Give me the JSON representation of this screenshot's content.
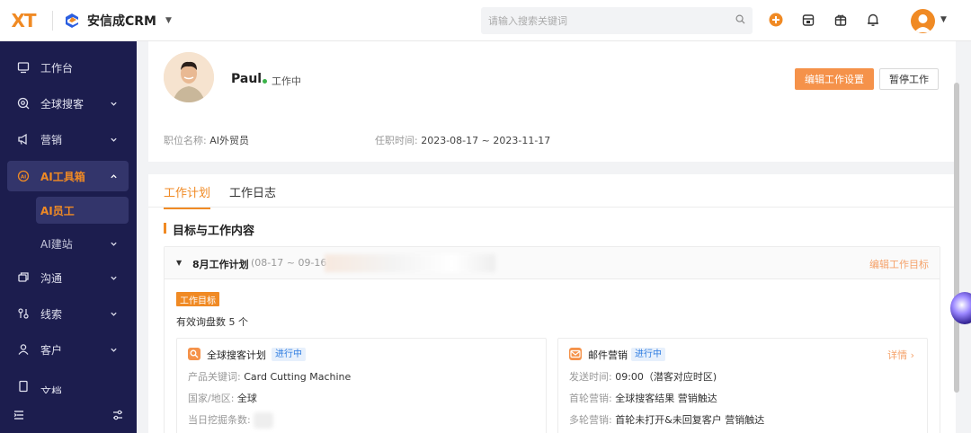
{
  "topbar": {
    "logo": "XT",
    "brand_name": "安信成CRM",
    "search_placeholder": "请输入搜索关键词"
  },
  "sidebar": {
    "items": [
      {
        "label": "工作台",
        "icon": "monitor-icon"
      },
      {
        "label": "全球搜客",
        "icon": "globe-search-icon"
      },
      {
        "label": "营销",
        "icon": "megaphone-icon"
      },
      {
        "label": "AI工具箱",
        "icon": "ai-toolbox-icon"
      },
      {
        "label": "沟通",
        "icon": "chat-icon"
      },
      {
        "label": "线索",
        "icon": "leads-icon"
      },
      {
        "label": "客户",
        "icon": "customer-icon"
      },
      {
        "label": "文档",
        "icon": "document-icon"
      }
    ],
    "sub_items": [
      {
        "label": "AI员工"
      },
      {
        "label": "AI建站"
      }
    ]
  },
  "profile": {
    "name": "Paul",
    "status": "工作中",
    "edit_button": "编辑工作设置",
    "pause_button": "暂停工作",
    "position_label": "职位名称:",
    "position_value": "AI外贸员",
    "tenure_label": "任职时间:",
    "tenure_value": "2023-08-17 ~ 2023-11-17"
  },
  "tabs": [
    {
      "label": "工作计划",
      "active": true
    },
    {
      "label": "工作日志",
      "active": false
    }
  ],
  "section_title": "目标与工作内容",
  "plan": {
    "title": "8月工作计划",
    "range": "(08-17 ~ 09-16",
    "edit_link": "编辑工作目标",
    "goal_tag": "工作目标",
    "goal_text": "有效询盘数 5 个"
  },
  "cards": [
    {
      "title": "全球搜客计划",
      "badge": "进行中",
      "rows": [
        {
          "k": "产品关键词:",
          "v": "Card Cutting Machine"
        },
        {
          "k": "国家/地区:",
          "v": "全球"
        },
        {
          "k": "当日挖掘条数:",
          "v": ""
        }
      ]
    },
    {
      "title": "邮件营销",
      "badge": "进行中",
      "more": "详情",
      "rows": [
        {
          "k": "发送时间:",
          "v": "09:00（潜客对应时区)"
        },
        {
          "k": "首轮营销:",
          "v": "全球搜客结果 营销触达"
        },
        {
          "k": "多轮营销:",
          "v": "首轮未打开&未回复客户 营销触达"
        }
      ]
    }
  ],
  "colors": {
    "accent": "#f08a24",
    "sidebar_bg": "#1c1d4e",
    "badge_blue": "#2f7de1"
  }
}
